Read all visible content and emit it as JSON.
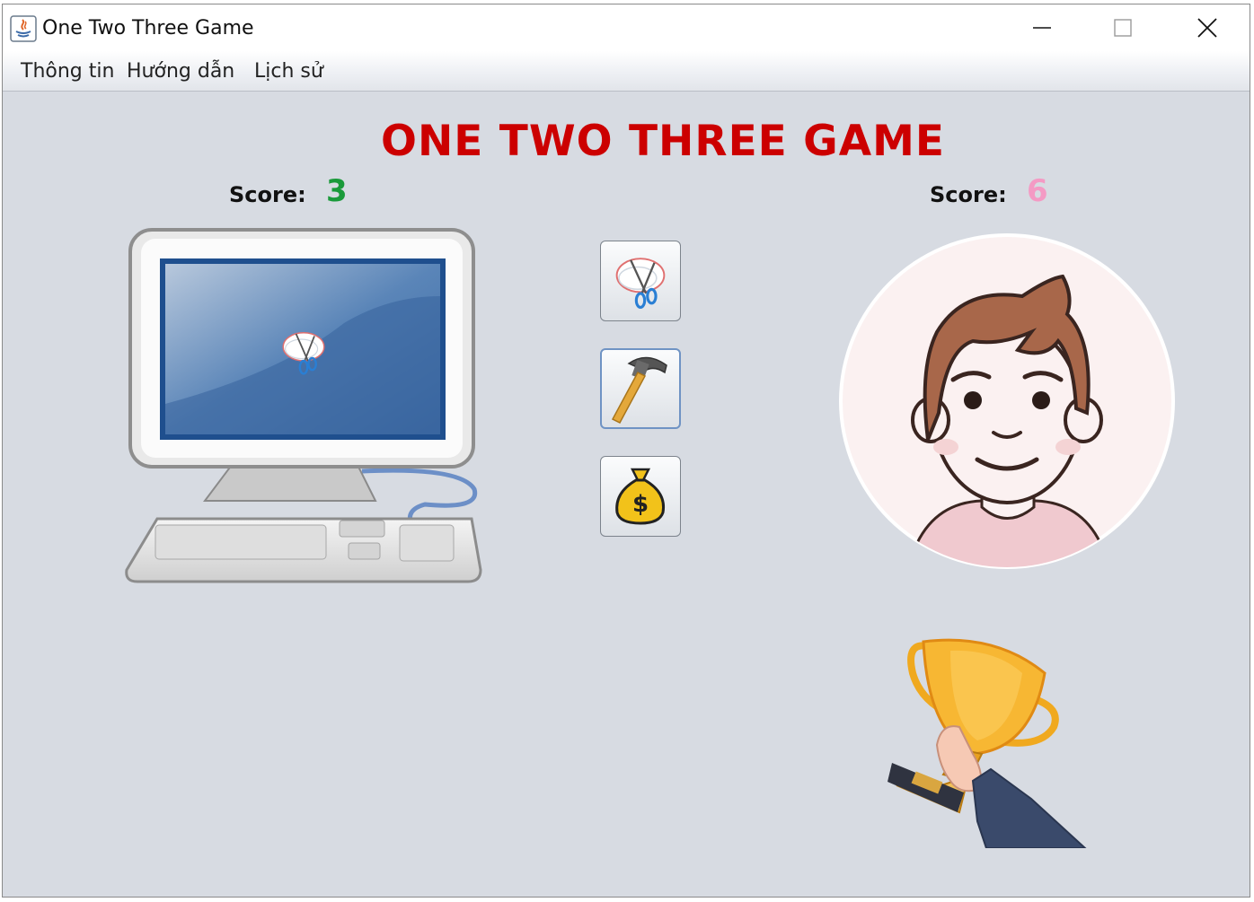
{
  "window": {
    "title": "One Two Three Game"
  },
  "menu": {
    "items": [
      "Thông tin",
      "Hướng dẫn",
      "Lịch sử"
    ]
  },
  "game": {
    "title": "ONE TWO THREE GAME",
    "computer": {
      "score_label": "Score:",
      "score": "3",
      "score_color": "#1a9a3a",
      "choice": "scissors-icon"
    },
    "player": {
      "score_label": "Score:",
      "score": "6",
      "score_color": "#f49ac4"
    },
    "choices": [
      {
        "icon": "scissors-icon"
      },
      {
        "icon": "hammer-icon",
        "selected": true
      },
      {
        "icon": "money-bag-icon"
      }
    ],
    "result_icon": "trophy-icon"
  }
}
